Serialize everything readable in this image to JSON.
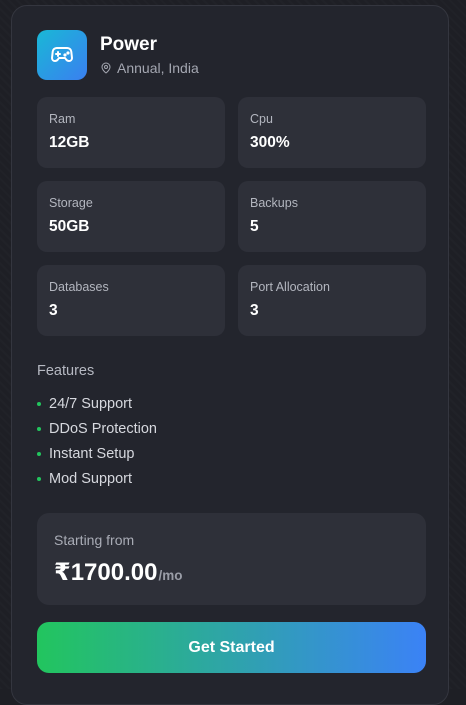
{
  "plan": {
    "name": "Power",
    "location": "Annual, India",
    "icon": "gamepad-icon",
    "location_icon": "map-pin-icon"
  },
  "specs": [
    {
      "label": "Ram",
      "value": "12GB"
    },
    {
      "label": "Cpu",
      "value": "300%"
    },
    {
      "label": "Storage",
      "value": "50GB"
    },
    {
      "label": "Backups",
      "value": "5"
    },
    {
      "label": "Databases",
      "value": "3"
    },
    {
      "label": "Port Allocation",
      "value": "3"
    }
  ],
  "features": {
    "title": "Features",
    "items": [
      "24/7 Support",
      "DDoS Protection",
      "Instant Setup",
      "Mod Support"
    ]
  },
  "pricing": {
    "label": "Starting from",
    "price": "₹1700.00",
    "period": "/mo"
  },
  "cta": {
    "label": "Get Started"
  },
  "colors": {
    "accent_green": "#22c55e",
    "accent_blue": "#3b82f6",
    "card_bg": "#23252d",
    "tile_bg": "#2e3039"
  }
}
